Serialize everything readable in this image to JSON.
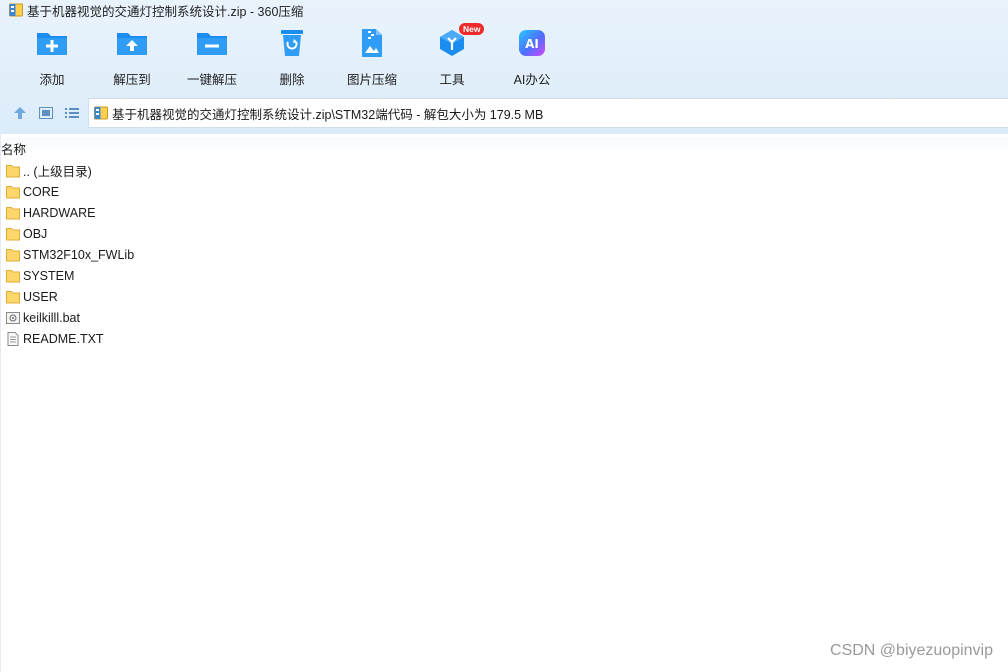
{
  "window": {
    "title": "基于机器视觉的交通灯控制系统设计.zip - 360压缩"
  },
  "toolbar": {
    "items": [
      {
        "label": "添加",
        "icon": "add-icon"
      },
      {
        "label": "解压到",
        "icon": "extract-to-icon"
      },
      {
        "label": "一键解压",
        "icon": "one-click-extract-icon"
      },
      {
        "label": "删除",
        "icon": "delete-icon"
      },
      {
        "label": "图片压缩",
        "icon": "image-compress-icon"
      },
      {
        "label": "工具",
        "icon": "tools-icon",
        "badge": "New"
      },
      {
        "label": "AI办公",
        "icon": "ai-office-icon",
        "icon_text": "AI"
      }
    ]
  },
  "address": {
    "path": "基于机器视觉的交通灯控制系统设计.zip\\STM32端代码 - 解包大小为 179.5 MB"
  },
  "columns": {
    "name": "名称"
  },
  "files": [
    {
      "name": ".. (上级目录)",
      "type": "folder"
    },
    {
      "name": "CORE",
      "type": "folder"
    },
    {
      "name": "HARDWARE",
      "type": "folder"
    },
    {
      "name": "OBJ",
      "type": "folder"
    },
    {
      "name": "STM32F10x_FWLib",
      "type": "folder"
    },
    {
      "name": "SYSTEM",
      "type": "folder"
    },
    {
      "name": "USER",
      "type": "folder"
    },
    {
      "name": "keilkilll.bat",
      "type": "batch-file"
    },
    {
      "name": "README.TXT",
      "type": "text-file"
    }
  ],
  "watermark": "CSDN @biyezuopinvip",
  "colors": {
    "toolbar_bg": "#dcecfa",
    "icon_blue": "#1b8cf0",
    "folder_yellow": "#ffd66b",
    "badge_red": "#ee2a2a"
  }
}
